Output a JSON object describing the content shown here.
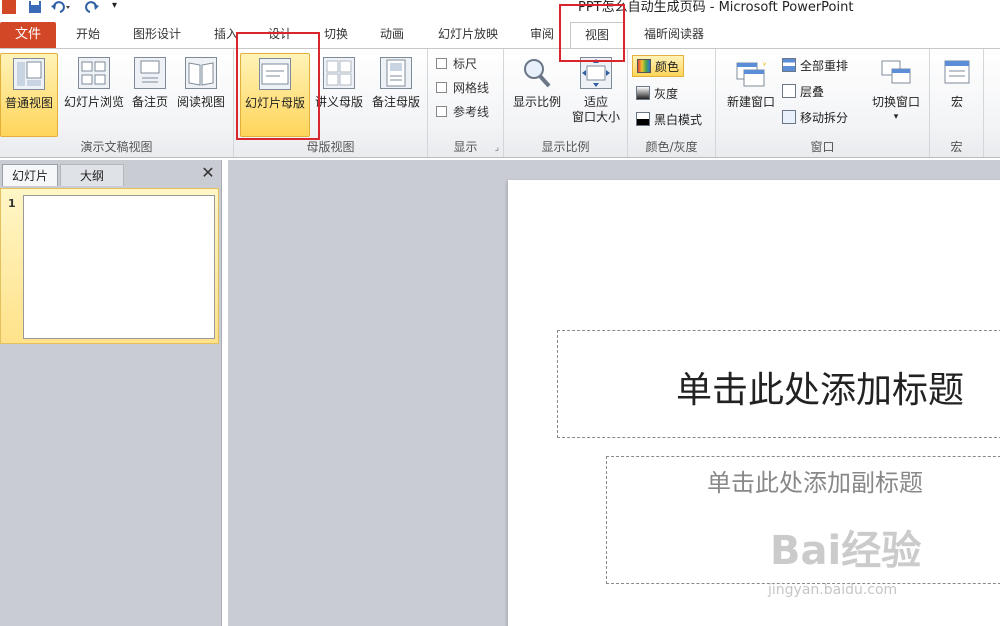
{
  "window": {
    "title": "PPT怎么自动生成页码  -  Microsoft PowerPoint"
  },
  "tabs": [
    {
      "label": "文件"
    },
    {
      "label": "开始"
    },
    {
      "label": "图形设计"
    },
    {
      "label": "插入"
    },
    {
      "label": "设计"
    },
    {
      "label": "切换"
    },
    {
      "label": "动画"
    },
    {
      "label": "幻灯片放映"
    },
    {
      "label": "审阅"
    },
    {
      "label": "视图"
    },
    {
      "label": "福昕阅读器"
    }
  ],
  "ribbon": {
    "presentation_views": {
      "label": "演示文稿视图",
      "buttons": [
        {
          "label": "普通视图"
        },
        {
          "label": "幻灯片浏览"
        },
        {
          "label": "备注页"
        },
        {
          "label": "阅读视图"
        }
      ]
    },
    "master_views": {
      "label": "母版视图",
      "buttons": [
        {
          "label": "幻灯片母版"
        },
        {
          "label": "讲义母版"
        },
        {
          "label": "备注母版"
        }
      ]
    },
    "show": {
      "label": "显示",
      "items": [
        {
          "label": "标尺"
        },
        {
          "label": "网格线"
        },
        {
          "label": "参考线"
        }
      ]
    },
    "zoom": {
      "label": "显示比例",
      "zoom_label": "显示比例",
      "fit_label_1": "适应",
      "fit_label_2": "窗口大小"
    },
    "color": {
      "label": "颜色/灰度",
      "items": [
        {
          "label": "颜色"
        },
        {
          "label": "灰度"
        },
        {
          "label": "黑白模式"
        }
      ]
    },
    "window": {
      "label": "窗口",
      "new_window": "新建窗口",
      "arrange_all": "全部重排",
      "cascade": "层叠",
      "move_split": "移动拆分",
      "switch_windows": "切换窗口"
    },
    "macros": {
      "label": "宏",
      "button": "宏"
    }
  },
  "panel": {
    "tab_slides": "幻灯片",
    "tab_outline": "大纲",
    "close": "✕",
    "slide_number": "1"
  },
  "slide": {
    "title_placeholder": "单击此处添加标题",
    "subtitle_placeholder": "单击此处添加副标题"
  },
  "watermark": {
    "brand": "Bai经验",
    "url": "jingyan.baidu.com"
  },
  "colors": {
    "file_tab": "#d24726",
    "highlight": "#d9262d",
    "active_button": "#ffd55a"
  }
}
